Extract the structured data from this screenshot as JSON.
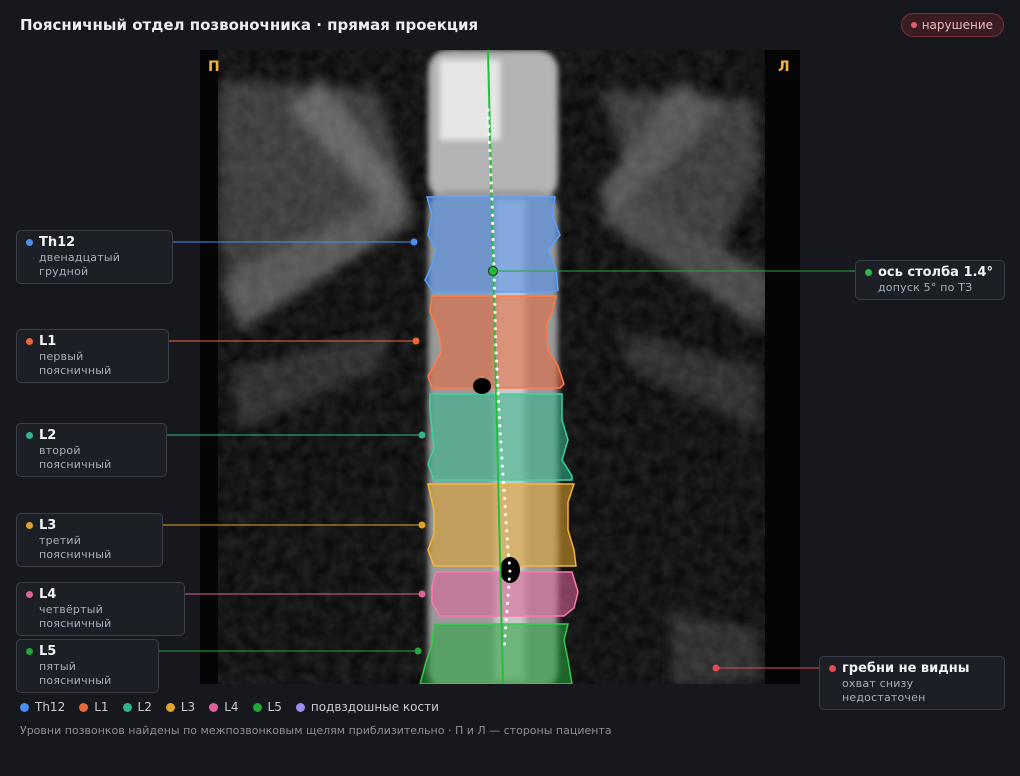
{
  "header": {
    "title": "Поясничный отдел позвоночника · прямая проекция",
    "status_badge": "нарушение",
    "status_color": "#e0606c"
  },
  "image": {
    "right_side_mark": "П",
    "left_side_mark": "Л"
  },
  "vertebrae": [
    {
      "id": "Th12",
      "label": "Th12",
      "description": "двенадцатый грудной",
      "color": "#4a8ff0"
    },
    {
      "id": "L1",
      "label": "L1",
      "description": "первый поясничный",
      "color": "#e9683a"
    },
    {
      "id": "L2",
      "label": "L2",
      "description": "второй поясничный",
      "color": "#2fb58c"
    },
    {
      "id": "L3",
      "label": "L3",
      "description": "третий поясничный",
      "color": "#e2a32a"
    },
    {
      "id": "L4",
      "label": "L4",
      "description": "четвёртый поясничный",
      "color": "#e0609a"
    },
    {
      "id": "L5",
      "label": "L5",
      "description": "пятый поясничный",
      "color": "#22a63c"
    }
  ],
  "axis_callout": {
    "title": "ось столба 1.4°",
    "subtitle": "допуск 5° по ТЗ",
    "color": "#2fb548"
  },
  "crest_callout": {
    "title": "гребни не видны",
    "subtitle": "охват снизу недостаточен",
    "color": "#e04a52"
  },
  "legend": [
    {
      "label": "Th12",
      "color": "#4a8ff0"
    },
    {
      "label": "L1",
      "color": "#e9683a"
    },
    {
      "label": "L2",
      "color": "#2fb58c"
    },
    {
      "label": "L3",
      "color": "#e2a32a"
    },
    {
      "label": "L4",
      "color": "#e0609a"
    },
    {
      "label": "L5",
      "color": "#22a63c"
    },
    {
      "label": "подвздошные кости",
      "color": "#9a8cf0"
    }
  ],
  "footnote": "Уровни позвонков найдены по межпозвонковым щелям приблизительно · П и Л — стороны пациента"
}
